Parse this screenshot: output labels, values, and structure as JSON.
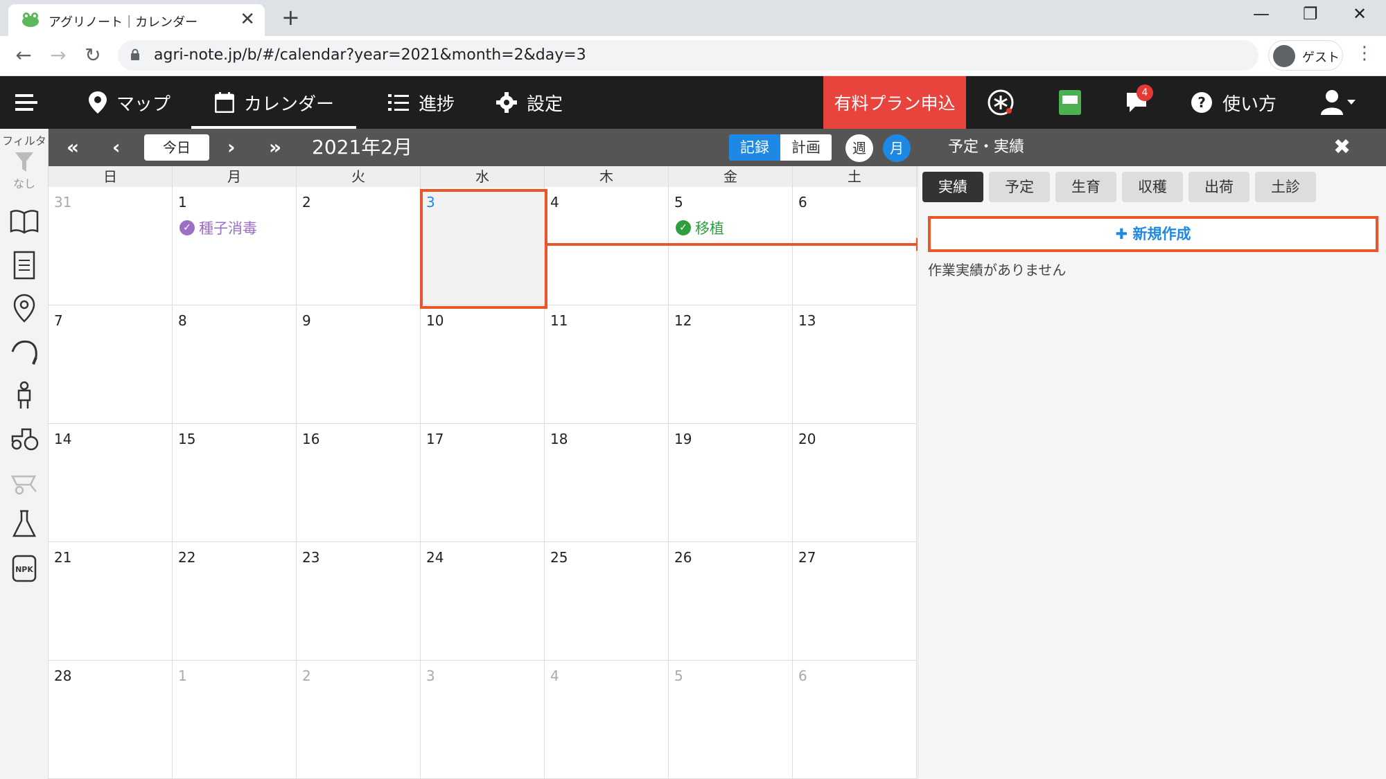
{
  "browser": {
    "tab_title": "アグリノート｜カレンダー",
    "tab_close": "✕",
    "new_tab": "+",
    "url": "agri-note.jp/b/#/calendar?year=2021&month=2&day=3",
    "profile_label": "ゲスト",
    "minimize": "—",
    "restore": "❐",
    "close": "✕"
  },
  "nav": {
    "map": "マップ",
    "calendar": "カレンダー",
    "progress": "進捗",
    "settings": "設定",
    "paid_plan": "有料プラン申込",
    "help": "使い方",
    "notification_count": "4"
  },
  "sidebar": {
    "filter_label": "フィルタ",
    "filter_none": "なし"
  },
  "toolbar": {
    "today": "今日",
    "month_label": "2021年2月",
    "record": "記録",
    "plan": "計画",
    "week": "週",
    "month": "月",
    "panel_title": "予定・実績",
    "close": "✖"
  },
  "calendar": {
    "weekdays": [
      "日",
      "月",
      "火",
      "水",
      "木",
      "金",
      "土"
    ],
    "weeks": [
      [
        "31",
        "1",
        "2",
        "3",
        "4",
        "5",
        "6"
      ],
      [
        "7",
        "8",
        "9",
        "10",
        "11",
        "12",
        "13"
      ],
      [
        "14",
        "15",
        "16",
        "17",
        "18",
        "19",
        "20"
      ],
      [
        "21",
        "22",
        "23",
        "24",
        "25",
        "26",
        "27"
      ],
      [
        "28",
        "1",
        "2",
        "3",
        "4",
        "5",
        "6"
      ]
    ],
    "events": {
      "seed_disinfection": "種子消毒",
      "transplant": "移植"
    },
    "colors": {
      "seed_disinfection": "#9b6fc3",
      "transplant": "#2e9e3e"
    }
  },
  "panel": {
    "tabs": [
      "実績",
      "予定",
      "生育",
      "収穫",
      "出荷",
      "土診"
    ],
    "new_button": "✚ 新規作成",
    "empty_message": "作業実績がありません"
  }
}
